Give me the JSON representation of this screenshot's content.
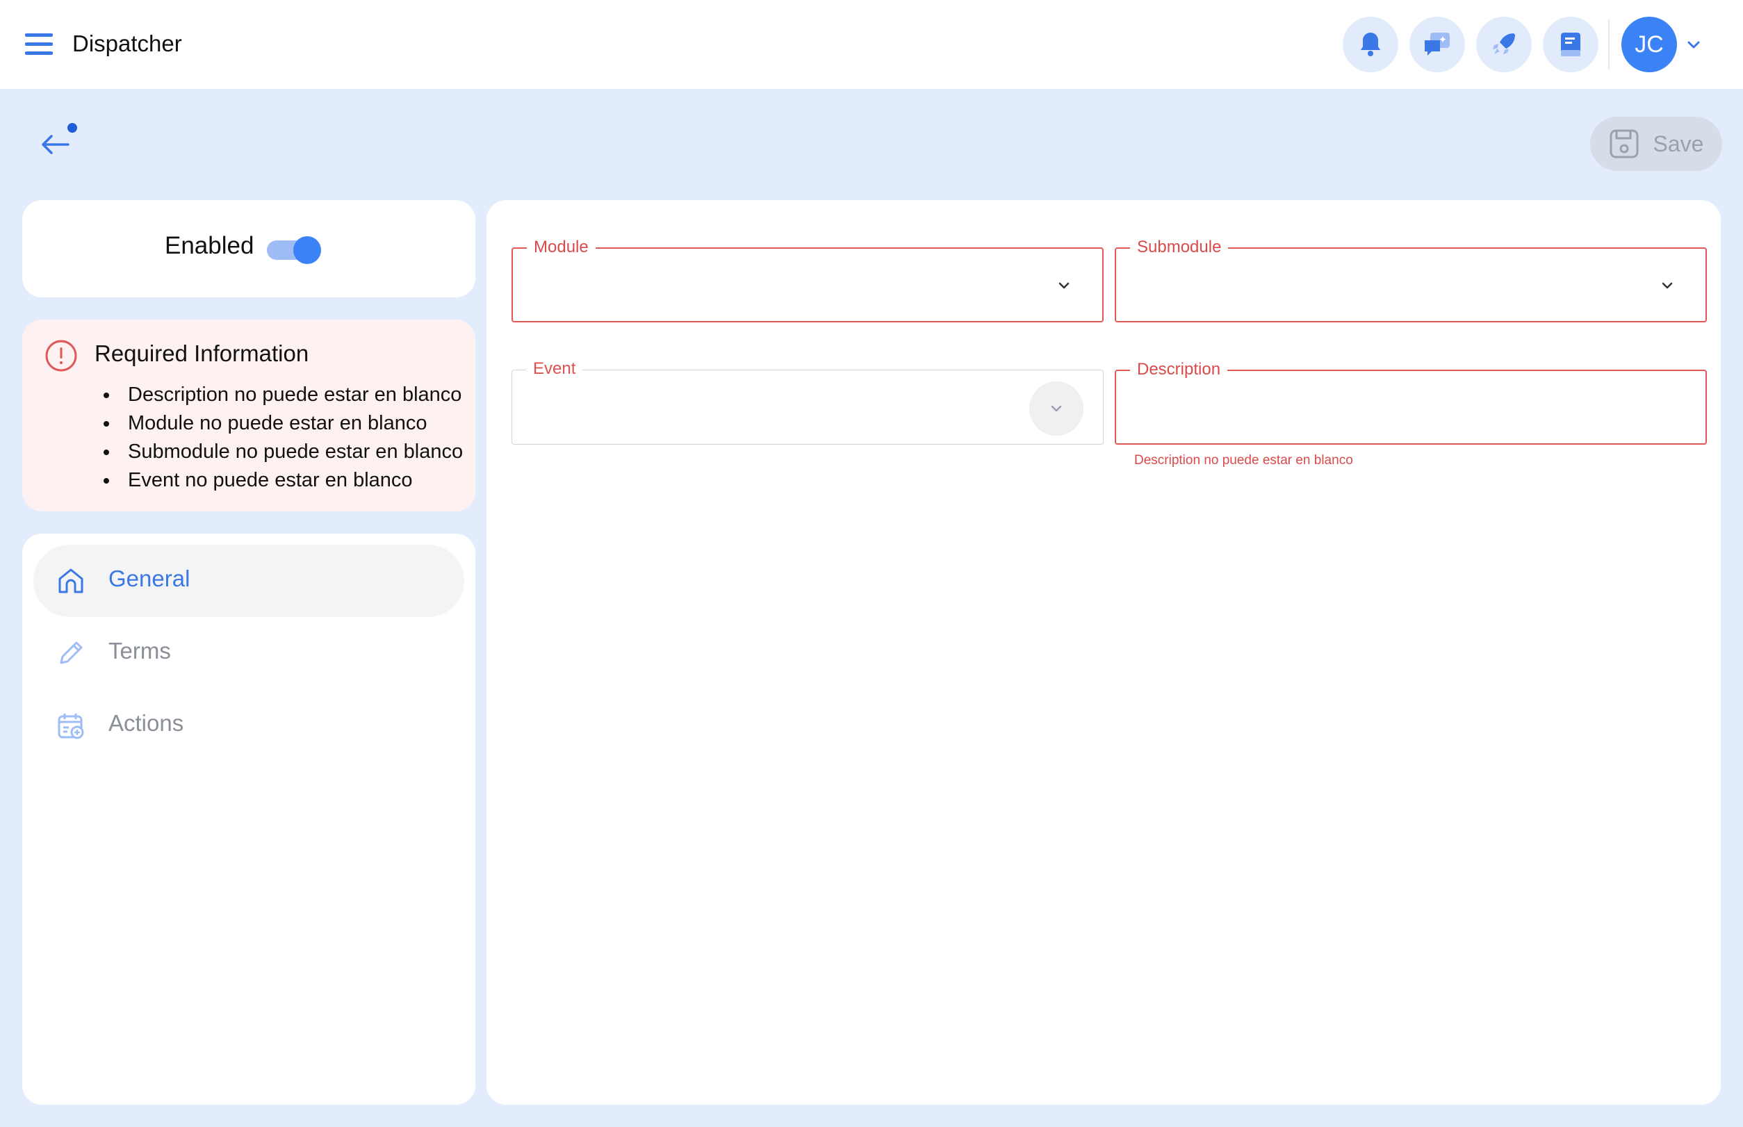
{
  "header": {
    "title": "Dispatcher",
    "avatar_initials": "JC"
  },
  "toolbar": {
    "save_label": "Save"
  },
  "status": {
    "enabled_label": "Enabled",
    "enabled": true
  },
  "required_info": {
    "title": "Required Information",
    "items": [
      "Description no puede estar en blanco",
      "Module no puede estar en blanco",
      "Submodule no puede estar en blanco",
      "Event no puede estar en blanco"
    ]
  },
  "nav": {
    "items": [
      {
        "label": "General",
        "icon": "home-icon",
        "active": true
      },
      {
        "label": "Terms",
        "icon": "pencil-icon",
        "active": false
      },
      {
        "label": "Actions",
        "icon": "calendar-add-icon",
        "active": false
      }
    ]
  },
  "form": {
    "module": {
      "label": "Module",
      "value": ""
    },
    "submodule": {
      "label": "Submodule",
      "value": ""
    },
    "event": {
      "label": "Event",
      "value": ""
    },
    "description": {
      "label": "Description",
      "value": "",
      "error": "Description no puede estar en blanco"
    }
  },
  "colors": {
    "accent": "#3b82f6",
    "error": "#e25656",
    "background": "#e3ecfc"
  }
}
